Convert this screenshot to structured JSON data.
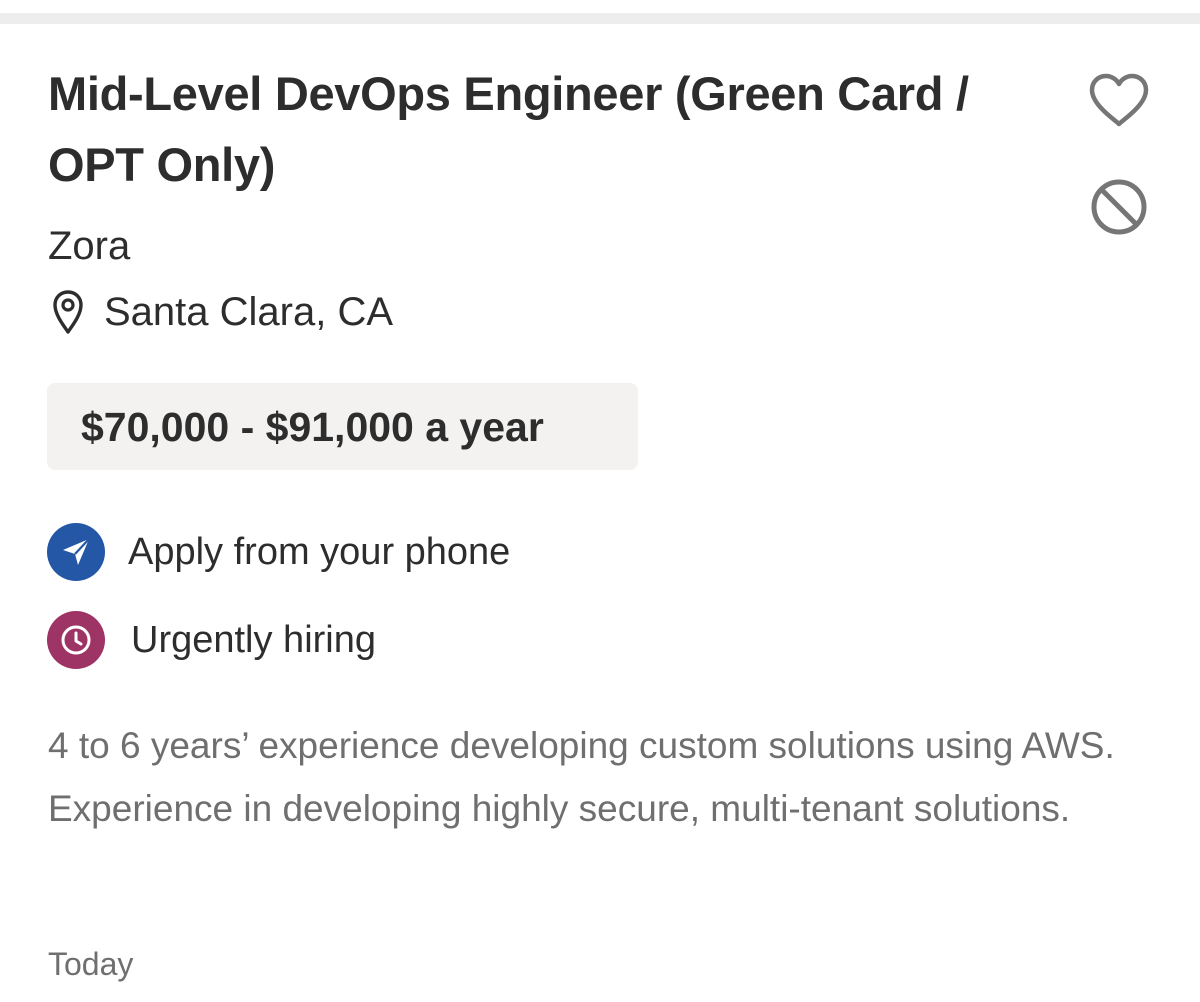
{
  "job": {
    "title": "Mid-Level DevOps Engineer (Green Card / OPT Only)",
    "company": "Zora",
    "location": "Santa Clara, CA",
    "salary": "$70,000 - $91,000 a year",
    "features": [
      {
        "label": "Apply from your phone",
        "icon": "paper-plane-icon",
        "color": "#2557a7"
      },
      {
        "label": "Urgently hiring",
        "icon": "clock-icon",
        "color": "#9e3465"
      }
    ],
    "snippet": "4 to 6 years’ experience developing custom solutions using AWS. Experience in developing highly secure, multi-tenant solutions.",
    "posted": "Today"
  },
  "actions": {
    "save_icon": "heart-icon",
    "hide_icon": "block-icon"
  },
  "colors": {
    "text": "#2d2d2d",
    "muted": "#6f6f6f",
    "salary_bg": "#f3f2f1",
    "icon_gray": "#767676"
  }
}
